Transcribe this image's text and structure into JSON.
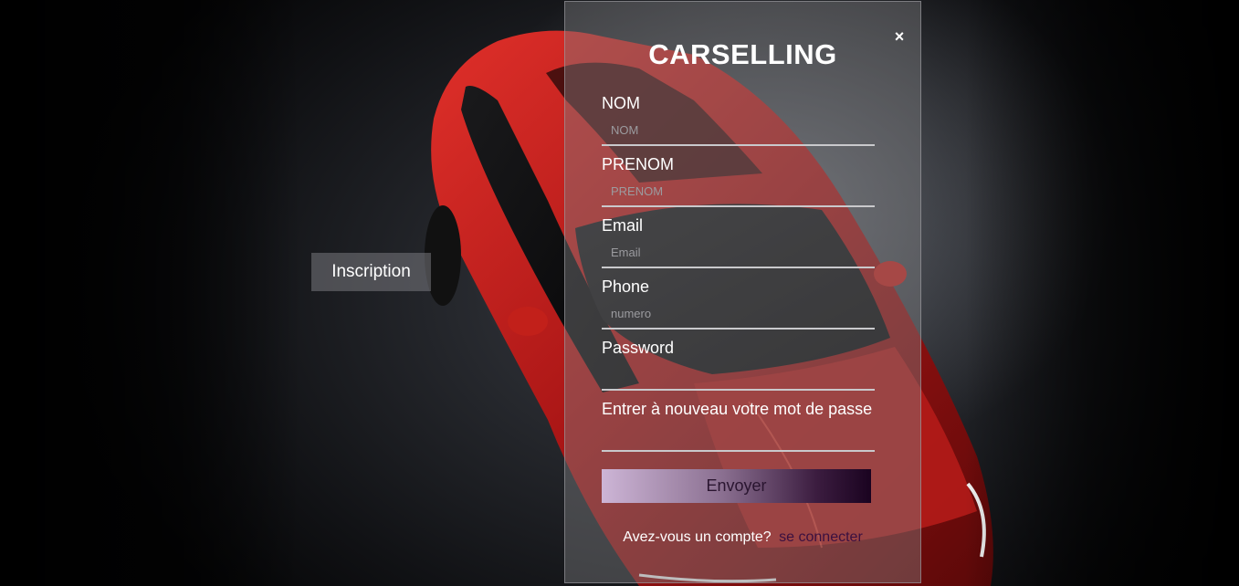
{
  "tab": {
    "label": "Inscription"
  },
  "modal": {
    "title": "CARSELLING",
    "close_symbol": "×",
    "fields": [
      {
        "label": "NOM",
        "placeholder": "NOM",
        "value": ""
      },
      {
        "label": "PRENOM",
        "placeholder": "PRENOM",
        "value": ""
      },
      {
        "label": "Email",
        "placeholder": "Email",
        "value": ""
      },
      {
        "label": "Phone",
        "placeholder": "numero",
        "value": ""
      },
      {
        "label": "Password",
        "placeholder": "",
        "value": ""
      },
      {
        "label": "Entrer à nouveau votre mot de passe",
        "placeholder": "",
        "value": ""
      }
    ],
    "submit_label": "Envoyer",
    "footer": {
      "question": "Avez-vous un compte?",
      "link_label": "se connecter"
    }
  },
  "colors": {
    "car": "#b01a1a",
    "button_gradient_start": "#cdb5d6",
    "button_gradient_end": "#1a0320",
    "link": "#3a1040"
  },
  "icons": {
    "close": "close-icon"
  }
}
